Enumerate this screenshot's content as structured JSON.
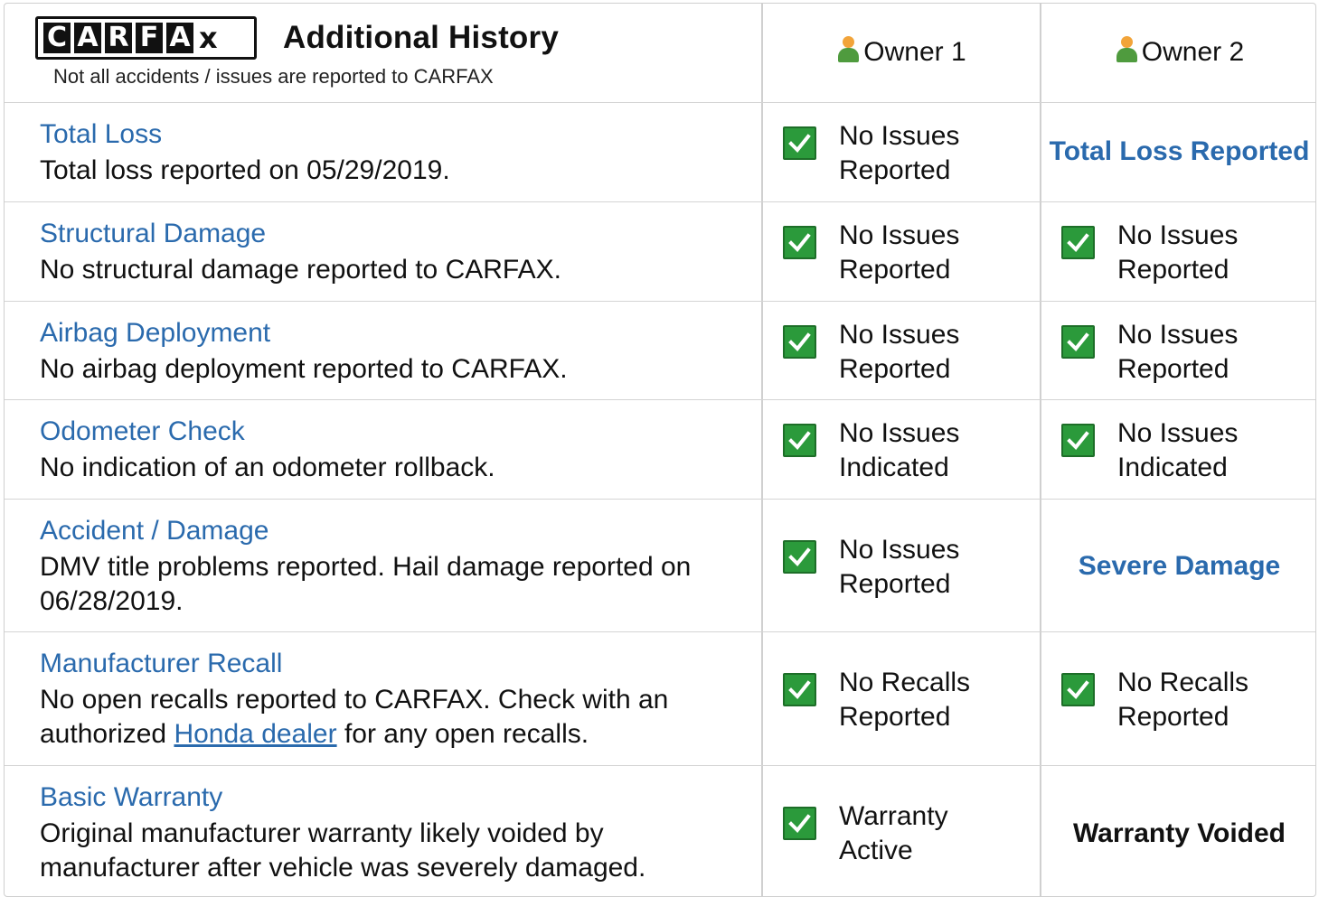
{
  "header": {
    "logo_letters": [
      "C",
      "A",
      "R",
      "F",
      "A"
    ],
    "logo_x": "x",
    "title": "Additional History",
    "subtitle": "Not all accidents / issues are reported to CARFAX",
    "owner1": "Owner 1",
    "owner2": "Owner 2"
  },
  "rows": [
    {
      "category": "Total Loss",
      "description": "Total loss reported on 05/29/2019.",
      "owner1": {
        "line1": "No Issues",
        "line2": "Reported"
      },
      "owner2": {
        "text": "Total Loss Reported"
      }
    },
    {
      "category": "Structural Damage",
      "description": "No structural damage reported to CARFAX.",
      "owner1": {
        "line1": "No Issues",
        "line2": "Reported"
      },
      "owner2": {
        "line1": "No Issues",
        "line2": "Reported"
      }
    },
    {
      "category": "Airbag Deployment",
      "description": "No airbag deployment reported to CARFAX.",
      "owner1": {
        "line1": "No Issues",
        "line2": "Reported"
      },
      "owner2": {
        "line1": "No Issues",
        "line2": "Reported"
      }
    },
    {
      "category": "Odometer Check",
      "description": "No indication of an odometer rollback.",
      "owner1": {
        "line1": "No Issues",
        "line2": "Indicated"
      },
      "owner2": {
        "line1": "No Issues",
        "line2": "Indicated"
      }
    },
    {
      "category": "Accident / Damage",
      "description_line1": "DMV title problems reported. Hail damage reported on",
      "description_line2": "06/28/2019.",
      "owner1": {
        "line1": "No Issues",
        "line2": "Reported"
      },
      "owner2": {
        "text": "Severe Damage"
      }
    },
    {
      "category": "Manufacturer Recall",
      "description_line1": "No open recalls reported to CARFAX. Check with an",
      "description_prefix": "authorized",
      "description_link": "Honda dealer",
      "description_suffix": "for any open recalls.",
      "owner1": {
        "line1": "No Recalls",
        "line2": "Reported"
      },
      "owner2": {
        "line1": "No Recalls",
        "line2": "Reported"
      }
    },
    {
      "category": "Basic Warranty",
      "description_line1": "Original manufacturer warranty likely voided by",
      "description_line2": "manufacturer after vehicle was severely damaged.",
      "owner1": {
        "line1": "Warranty",
        "line2": "Active"
      },
      "owner2": {
        "text": "Warranty Voided"
      }
    }
  ],
  "colors": {
    "link_blue": "#2a6aad",
    "check_green": "#2b9a3b",
    "text": "#111111",
    "border": "#d4d4d4"
  },
  "icons": {
    "check": "checkmark-icon",
    "owner": "person-icon"
  }
}
